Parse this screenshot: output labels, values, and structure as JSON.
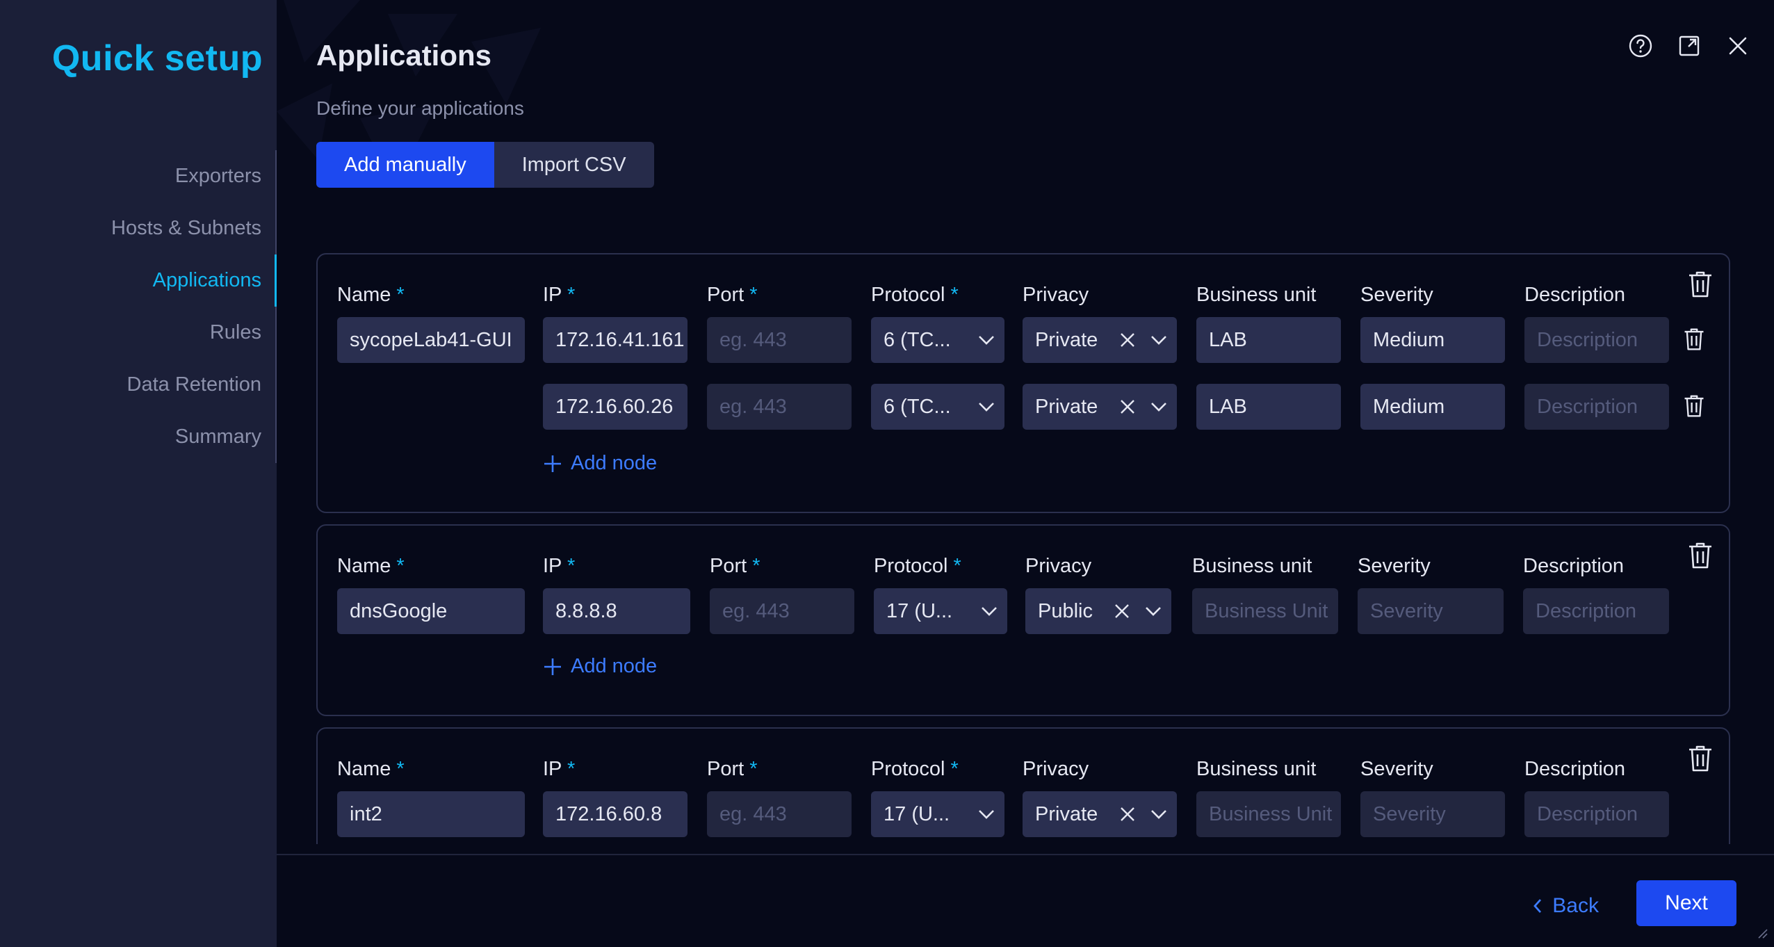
{
  "sidebar": {
    "title": "Quick setup",
    "steps": [
      {
        "label": "Exporters"
      },
      {
        "label": "Hosts & Subnets"
      },
      {
        "label": "Applications"
      },
      {
        "label": "Rules"
      },
      {
        "label": "Data Retention"
      },
      {
        "label": "Summary"
      }
    ],
    "active_step": "Applications"
  },
  "header": {
    "title": "Applications",
    "subtitle": "Define your applications",
    "icons": [
      "help-icon",
      "expand-icon",
      "close-icon"
    ]
  },
  "mode": {
    "add_manually": "Add manually",
    "import_csv": "Import CSV"
  },
  "labels": {
    "name": "Name",
    "ip": "IP",
    "port": "Port",
    "protocol": "Protocol",
    "privacy": "Privacy",
    "business_unit": "Business unit",
    "severity": "Severity",
    "description": "Description",
    "required_mark": "*"
  },
  "placeholders": {
    "port": "eg. 443",
    "business_unit": "Business Unit",
    "severity": "Severity",
    "description": "Description"
  },
  "add_node_label": "Add node",
  "applications": [
    {
      "name": "sycopeLab41-GUI",
      "nodes": [
        {
          "ip": "172.16.41.161",
          "port": "",
          "protocol": "6 (TC...",
          "privacy": "Private",
          "business_unit": "LAB",
          "severity": "Medium",
          "description": ""
        },
        {
          "ip": "172.16.60.26",
          "port": "",
          "protocol": "6 (TC...",
          "privacy": "Private",
          "business_unit": "LAB",
          "severity": "Medium",
          "description": ""
        }
      ]
    },
    {
      "name": "dnsGoogle",
      "nodes": [
        {
          "ip": "8.8.8.8",
          "port": "",
          "protocol": "17 (U...",
          "privacy": "Public",
          "business_unit": "",
          "severity": "",
          "description": ""
        }
      ]
    },
    {
      "name": "int2",
      "nodes": [
        {
          "ip": "172.16.60.8",
          "port": "",
          "protocol": "17 (U...",
          "privacy": "Private",
          "business_unit": "",
          "severity": "",
          "description": ""
        }
      ]
    }
  ],
  "footer": {
    "back": "Back",
    "next": "Next"
  },
  "colors": {
    "accent": "#12b8f2",
    "primary_button": "#1d49f0",
    "link": "#3d7cff",
    "sidebar_bg": "#1b1f38",
    "main_bg": "#060919"
  }
}
